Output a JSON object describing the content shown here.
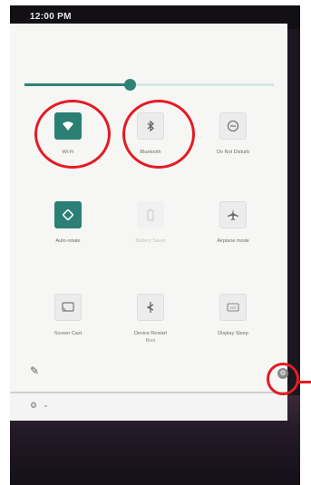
{
  "status_bar": {
    "time": "12:00 PM"
  },
  "brightness": {
    "level": 0.42
  },
  "tiles": [
    {
      "label": "Wi-Fi",
      "sub": "",
      "state": "on"
    },
    {
      "label": "Bluetooth",
      "sub": "",
      "state": "off"
    },
    {
      "label": "Do Not Disturb",
      "sub": "",
      "state": "off"
    },
    {
      "label": "Auto-rotate",
      "sub": "",
      "state": "on"
    },
    {
      "label": "Battery Saver",
      "sub": "",
      "state": "dim"
    },
    {
      "label": "Airplane mode",
      "sub": "",
      "state": "off"
    },
    {
      "label": "Screen Cast",
      "sub": "",
      "state": "off"
    },
    {
      "label": "Device Restart",
      "sub": "Boot",
      "state": "off"
    },
    {
      "label": "Display Sleep",
      "sub": "",
      "state": "off"
    }
  ],
  "icons": {
    "wifi": "wifi-icon",
    "bluetooth": "bluetooth-icon",
    "dnd": "do-not-disturb-icon",
    "rotate": "auto-rotate-icon",
    "battery": "battery-saver-icon",
    "airplane": "airplane-icon",
    "cast": "screen-cast-icon",
    "restart": "restart-icon",
    "sleep": "display-sleep-icon",
    "edit": "pencil-icon",
    "settings": "gear-icon"
  },
  "colors": {
    "accent": "#2b7f74",
    "highlight": "#e41b23"
  }
}
